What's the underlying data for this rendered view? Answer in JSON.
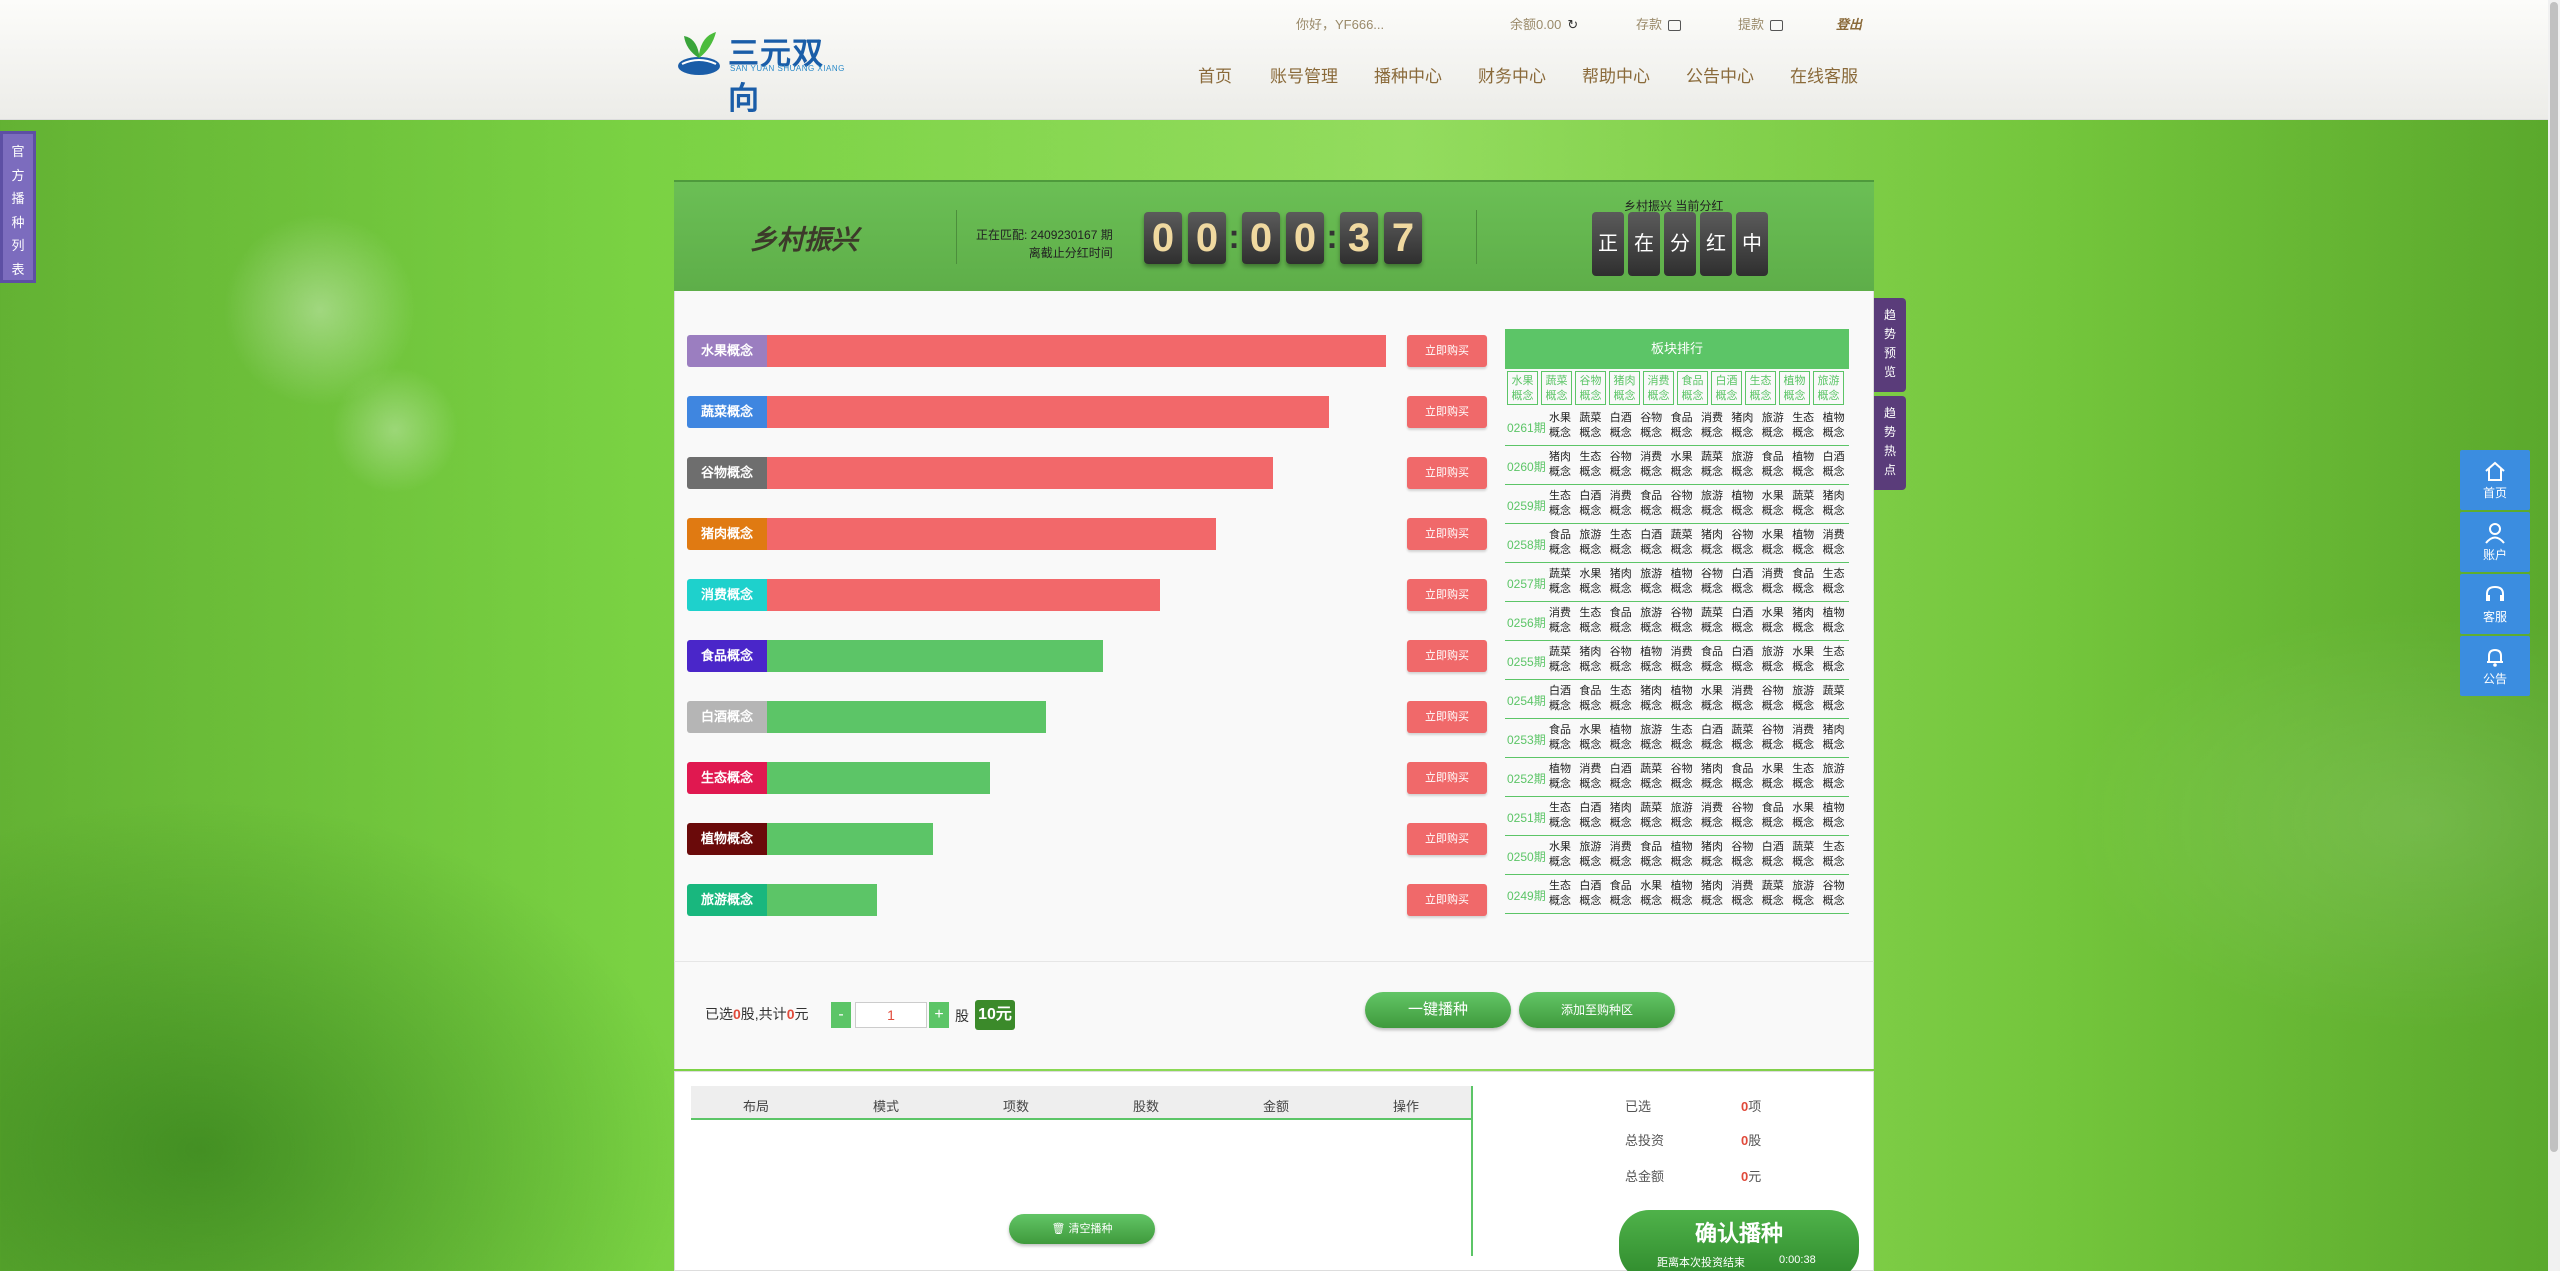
{
  "header": {
    "logo_text": "三元双向",
    "logo_sub": "SAN YUAN SHUANG XIANG",
    "greeting": "你好，YF666...",
    "balance": "余额0.00",
    "deposit": "存款",
    "withdraw": "提款",
    "logout": "登出",
    "nav": [
      "首页",
      "账号管理",
      "播种中心",
      "财务中心",
      "帮助中心",
      "公告中心",
      "在线客服"
    ]
  },
  "left_sidebar": {
    "chars": [
      "官",
      "方",
      "播",
      "种",
      "列",
      "表"
    ]
  },
  "panel": {
    "title": "乡村振兴",
    "issue_line": "正在匹配: 2409230167 期",
    "issue_sub": "离截止分红时间",
    "clock": [
      "0",
      "0",
      "0",
      "0",
      "3",
      "7"
    ],
    "right_title": "乡村振兴 当前分红",
    "status_chars": [
      "正",
      "在",
      "分",
      "红",
      "中"
    ]
  },
  "rows": [
    {
      "label": "水果概念",
      "color": "#9b7ec0",
      "value": 0.985,
      "bar_color": "#f2686a"
    },
    {
      "label": "蔬菜概念",
      "color": "#3f86e0",
      "value": 0.895,
      "bar_color": "#f2686a"
    },
    {
      "label": "谷物概念",
      "color": "#6e6e6e",
      "value": 0.805,
      "bar_color": "#f2686a"
    },
    {
      "label": "猪肉概念",
      "color": "#e07a12",
      "value": 0.715,
      "bar_color": "#f2686a"
    },
    {
      "label": "消费概念",
      "color": "#1ed1cc",
      "value": 0.625,
      "bar_color": "#f2686a"
    },
    {
      "label": "食品概念",
      "color": "#4a26c9",
      "value": 0.535,
      "bar_color": "#5cc567"
    },
    {
      "label": "白酒概念",
      "color": "#b5b5b5",
      "value": 0.445,
      "bar_color": "#5cc567"
    },
    {
      "label": "生态概念",
      "color": "#e01850",
      "value": 0.355,
      "bar_color": "#5cc567"
    },
    {
      "label": "植物概念",
      "color": "#6a0a0a",
      "value": 0.265,
      "bar_color": "#5cc567"
    },
    {
      "label": "旅游概念",
      "color": "#19b77e",
      "value": 0.175,
      "bar_color": "#5cc567"
    }
  ],
  "buy_label": "立即购买",
  "ranking": {
    "title": "板块排行",
    "chips": [
      [
        "水果",
        "概念"
      ],
      [
        "蔬菜",
        "概念"
      ],
      [
        "谷物",
        "概念"
      ],
      [
        "猪肉",
        "概念"
      ],
      [
        "消费",
        "概念"
      ],
      [
        "食品",
        "概念"
      ],
      [
        "白酒",
        "概念"
      ],
      [
        "生态",
        "概念"
      ],
      [
        "植物",
        "概念"
      ],
      [
        "旅游",
        "概念"
      ]
    ],
    "rows": [
      {
        "no": "0261期",
        "items": [
          "水果",
          "蔬菜",
          "白酒",
          "谷物",
          "食品",
          "消费",
          "猪肉",
          "旅游",
          "生态",
          "植物"
        ]
      },
      {
        "no": "0260期",
        "items": [
          "猪肉",
          "生态",
          "谷物",
          "消费",
          "水果",
          "蔬菜",
          "旅游",
          "食品",
          "植物",
          "白酒"
        ]
      },
      {
        "no": "0259期",
        "items": [
          "生态",
          "白酒",
          "消费",
          "食品",
          "谷物",
          "旅游",
          "植物",
          "水果",
          "蔬菜",
          "猪肉"
        ]
      },
      {
        "no": "0258期",
        "items": [
          "食品",
          "旅游",
          "生态",
          "白酒",
          "蔬菜",
          "猪肉",
          "谷物",
          "水果",
          "植物",
          "消费"
        ]
      },
      {
        "no": "0257期",
        "items": [
          "蔬菜",
          "水果",
          "猪肉",
          "旅游",
          "植物",
          "谷物",
          "白酒",
          "消费",
          "食品",
          "生态"
        ]
      },
      {
        "no": "0256期",
        "items": [
          "消费",
          "生态",
          "食品",
          "旅游",
          "谷物",
          "蔬菜",
          "白酒",
          "水果",
          "猪肉",
          "植物"
        ]
      },
      {
        "no": "0255期",
        "items": [
          "蔬菜",
          "猪肉",
          "谷物",
          "植物",
          "消费",
          "食品",
          "白酒",
          "旅游",
          "水果",
          "生态"
        ]
      },
      {
        "no": "0254期",
        "items": [
          "白酒",
          "食品",
          "生态",
          "猪肉",
          "植物",
          "水果",
          "消费",
          "谷物",
          "旅游",
          "蔬菜"
        ]
      },
      {
        "no": "0253期",
        "items": [
          "食品",
          "水果",
          "植物",
          "旅游",
          "生态",
          "白酒",
          "蔬菜",
          "谷物",
          "消费",
          "猪肉"
        ]
      },
      {
        "no": "0252期",
        "items": [
          "植物",
          "消费",
          "白酒",
          "蔬菜",
          "谷物",
          "猪肉",
          "食品",
          "水果",
          "生态",
          "旅游"
        ]
      },
      {
        "no": "0251期",
        "items": [
          "生态",
          "白酒",
          "猪肉",
          "蔬菜",
          "旅游",
          "消费",
          "谷物",
          "食品",
          "水果",
          "植物"
        ]
      },
      {
        "no": "0250期",
        "items": [
          "水果",
          "旅游",
          "消费",
          "食品",
          "植物",
          "猪肉",
          "谷物",
          "白酒",
          "蔬菜",
          "生态"
        ]
      },
      {
        "no": "0249期",
        "items": [
          "生态",
          "白酒",
          "食品",
          "水果",
          "植物",
          "猪肉",
          "消费",
          "蔬菜",
          "旅游",
          "谷物"
        ]
      }
    ]
  },
  "order": {
    "selected_prefix": "已选",
    "selected_count": "0",
    "selected_mid": "股,共计",
    "total": "0",
    "yuan": "元",
    "minus": "-",
    "qty": "1",
    "plus": "+",
    "unit": "股",
    "price": "10元",
    "one_click": "一键播种",
    "add_cart": "添加至购种区"
  },
  "table": {
    "headers": [
      "布局",
      "模式",
      "项数",
      "股数",
      "金额",
      "操作"
    ],
    "clear": "清空播种"
  },
  "summary": {
    "selected_label": "已选",
    "selected_value": "0",
    "selected_unit": "项",
    "invest_label": "总投资",
    "invest_value": "0",
    "invest_unit": "股",
    "amount_label": "总金额",
    "amount_value": "0",
    "amount_unit": "元",
    "confirm": "确认播种",
    "countdown_label": "距离本次投资结束",
    "countdown": "0:00:38"
  },
  "right_tabs": [
    [
      "趋",
      "势",
      "预",
      "览"
    ],
    [
      "趋",
      "势",
      "热",
      "点"
    ]
  ],
  "float_buttons": [
    "首页",
    "账户",
    "客服",
    "公告"
  ]
}
